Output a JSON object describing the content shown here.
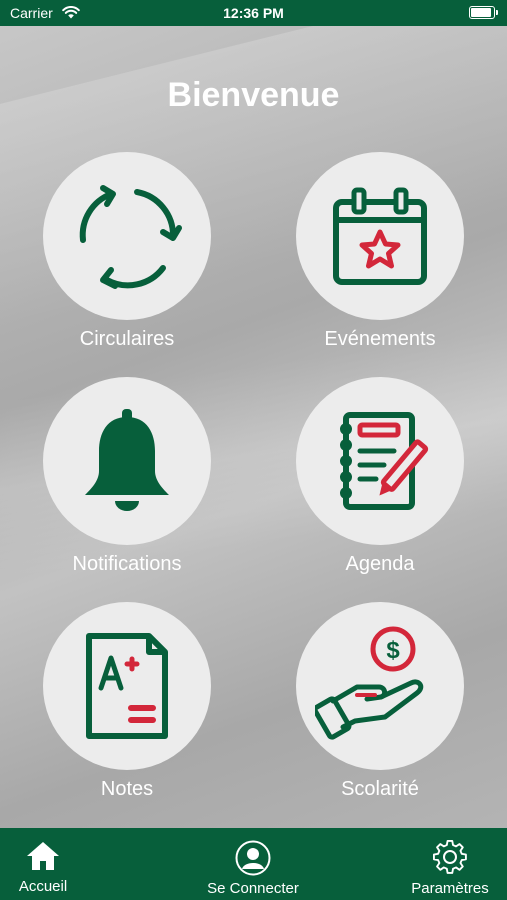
{
  "status_bar": {
    "carrier": "Carrier",
    "time": "12:36 PM",
    "battery_level": 0.9
  },
  "header": {
    "title": "Bienvenue"
  },
  "tiles": [
    {
      "label": "Circulaires",
      "icon": "recycle-arrows-icon"
    },
    {
      "label": "Evénements",
      "icon": "calendar-star-icon"
    },
    {
      "label": "Notifications",
      "icon": "bell-icon"
    },
    {
      "label": "Agenda",
      "icon": "notebook-pencil-icon"
    },
    {
      "label": "Notes",
      "icon": "grade-report-icon"
    },
    {
      "label": "Scolarité",
      "icon": "hand-coin-icon"
    }
  ],
  "tab_bar": {
    "home": {
      "label": "Accueil",
      "icon": "home-icon"
    },
    "login": {
      "label": "Se Connecter",
      "icon": "user-icon"
    },
    "settings": {
      "label": "Paramètres",
      "icon": "gear-icon"
    }
  },
  "colors": {
    "brand_green": "#075f3b",
    "accent_red": "#d3273a",
    "tile_bg": "#ececec"
  }
}
